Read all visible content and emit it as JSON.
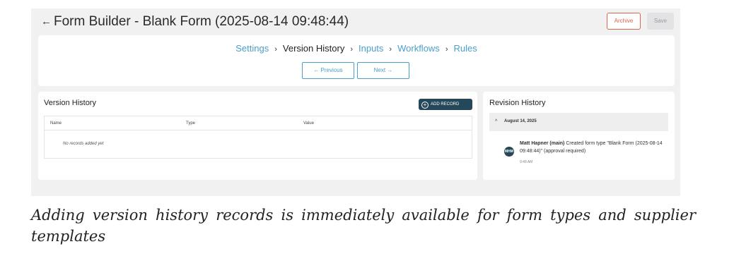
{
  "header": {
    "back_icon": "←",
    "title": "Form Builder - Blank Form (2025-08-14 09:48:44)",
    "archive_label": "Archive",
    "save_label": "Save"
  },
  "steps": {
    "items": [
      {
        "label": "Settings",
        "state": "link"
      },
      {
        "label": "Version History",
        "state": "current"
      },
      {
        "label": "Inputs",
        "state": "link"
      },
      {
        "label": "Workflows",
        "state": "link"
      },
      {
        "label": "Rules",
        "state": "link"
      }
    ],
    "separator": "›",
    "previous_label": "← Previous",
    "next_label": "Next →"
  },
  "version_history": {
    "title": "Version History",
    "add_label": "ADD RECORD",
    "columns": [
      "Name",
      "Type",
      "Value"
    ],
    "empty_message": "No records added yet"
  },
  "revision_history": {
    "title": "Revision History",
    "group_date": "August 14, 2025",
    "entry": {
      "avatar": "MHM",
      "user": "Matt Hapner (main)",
      "text": "Created form type \"Blank Form (2025-08-14 09:48:44)\" (approval required)",
      "time": "9:48 AM"
    }
  },
  "caption": "Adding version history records is immediately available for form types and supplier templates",
  "colors": {
    "accent": "#4a9fc9",
    "archive": "#d9654a",
    "dark_button": "#25475a",
    "background": "#f1f1f2"
  }
}
